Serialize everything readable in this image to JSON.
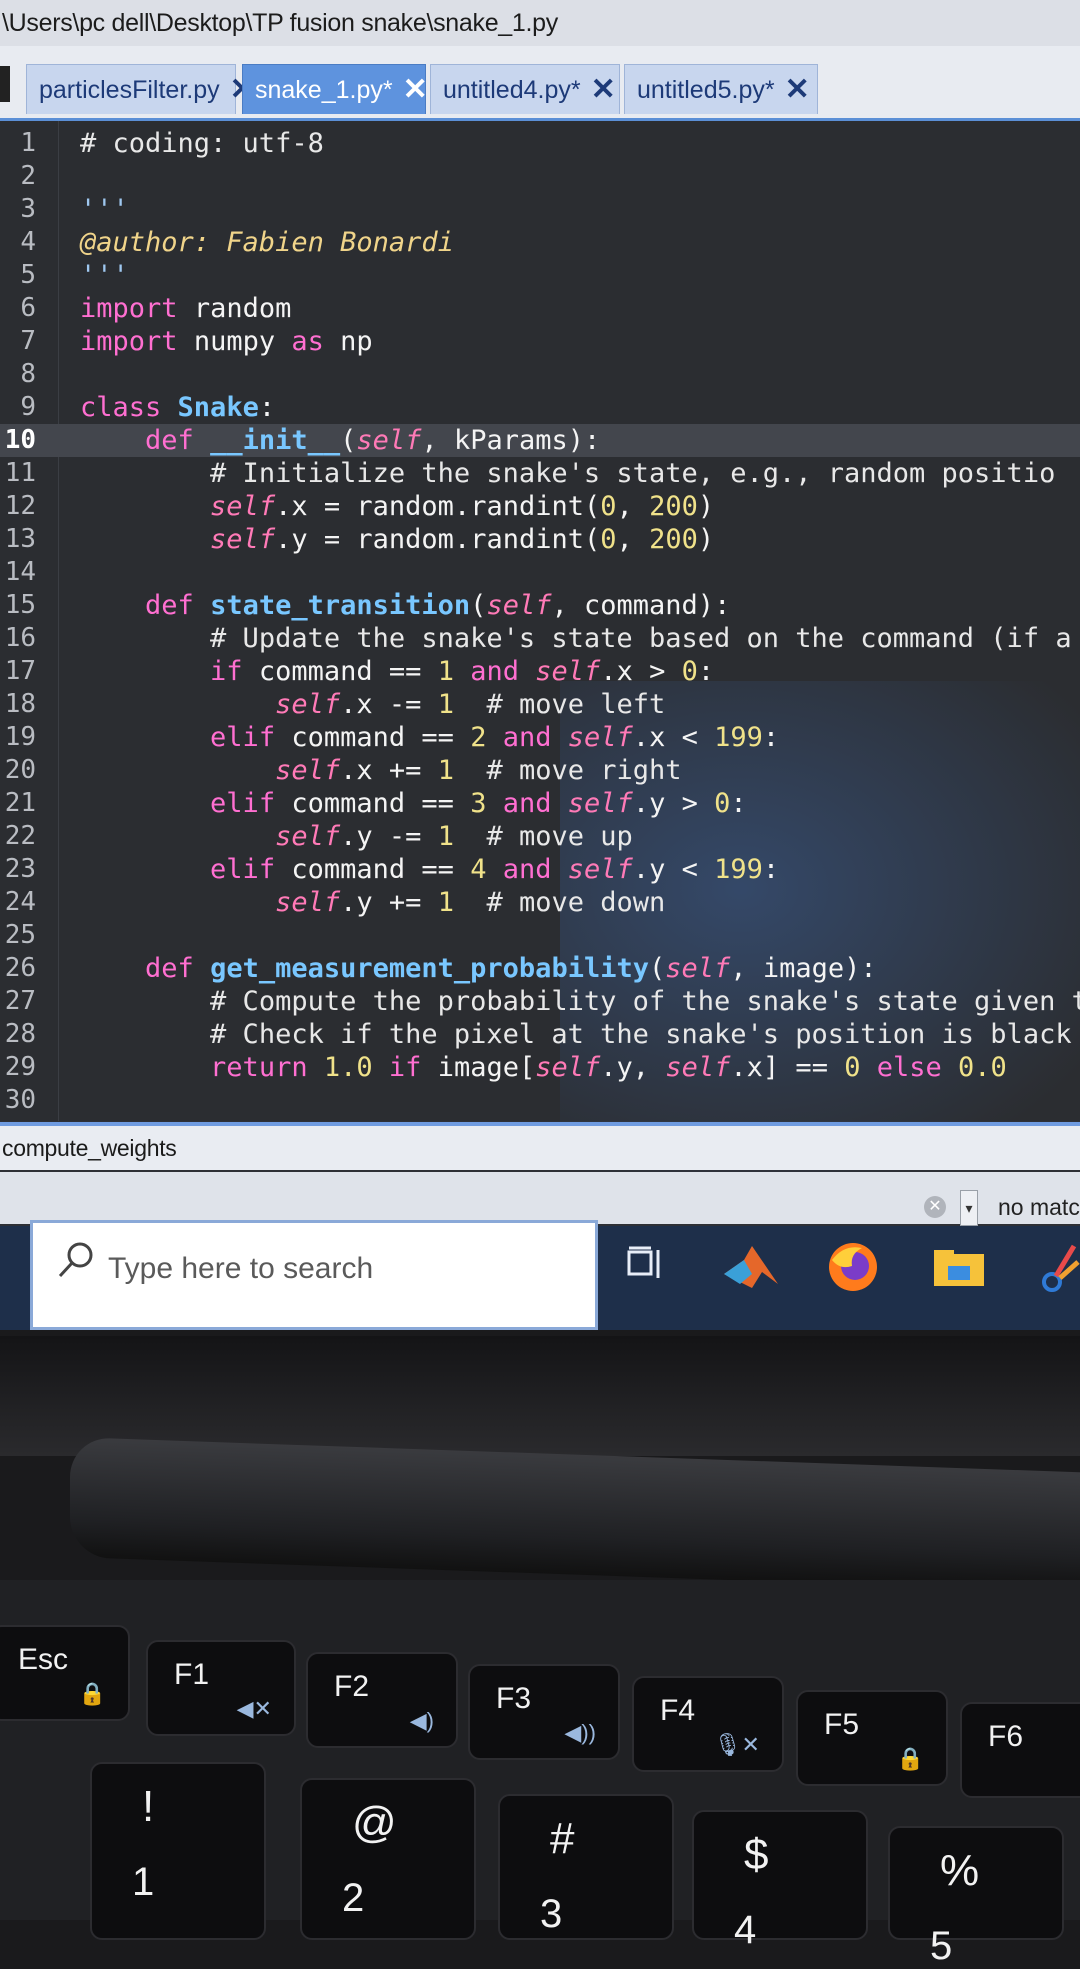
{
  "window": {
    "title": "\\Users\\pc dell\\Desktop\\TP fusion snake\\snake_1.py"
  },
  "tabs": [
    {
      "label": "particlesFilter.py",
      "active": false
    },
    {
      "label": "snake_1.py*",
      "active": true
    },
    {
      "label": "untitled4.py*",
      "active": false
    },
    {
      "label": "untitled5.py*",
      "active": false
    }
  ],
  "editor": {
    "current_line": 10,
    "lines": [
      {
        "n": "1",
        "text": "# coding: utf-8"
      },
      {
        "n": "2",
        "text": ""
      },
      {
        "n": "3",
        "text": "'''"
      },
      {
        "n": "4",
        "text": "@author: Fabien Bonardi"
      },
      {
        "n": "5",
        "text": "'''"
      },
      {
        "n": "6",
        "text": "import random"
      },
      {
        "n": "7",
        "text": "import numpy as np"
      },
      {
        "n": "8",
        "text": ""
      },
      {
        "n": "9",
        "text": "class Snake:"
      },
      {
        "n": "10",
        "text": "    def __init__(self, kParams):"
      },
      {
        "n": "11",
        "text": "        # Initialize the snake's state, e.g., random positio"
      },
      {
        "n": "12",
        "text": "        self.x = random.randint(0, 200)"
      },
      {
        "n": "13",
        "text": "        self.y = random.randint(0, 200)"
      },
      {
        "n": "14",
        "text": ""
      },
      {
        "n": "15",
        "text": "    def state_transition(self, command):"
      },
      {
        "n": "16",
        "text": "        # Update the snake's state based on the command (if a"
      },
      {
        "n": "17",
        "text": "        if command == 1 and self.x > 0:"
      },
      {
        "n": "18",
        "text": "            self.x -= 1  # move left"
      },
      {
        "n": "19",
        "text": "        elif command == 2 and self.x < 199:"
      },
      {
        "n": "20",
        "text": "            self.x += 1  # move right"
      },
      {
        "n": "21",
        "text": "        elif command == 3 and self.y > 0:"
      },
      {
        "n": "22",
        "text": "            self.y -= 1  # move up"
      },
      {
        "n": "23",
        "text": "        elif command == 4 and self.y < 199:"
      },
      {
        "n": "24",
        "text": "            self.y += 1  # move down"
      },
      {
        "n": "25",
        "text": ""
      },
      {
        "n": "26",
        "text": "    def get_measurement_probability(self, image):"
      },
      {
        "n": "27",
        "text": "        # Compute the probability of the snake's state given th"
      },
      {
        "n": "28",
        "text": "        # Check if the pixel at the snake's position is black i"
      },
      {
        "n": "29",
        "text": "        return 1.0 if image[self.y, self.x] == 0 else 0.0"
      },
      {
        "n": "30",
        "text": ""
      }
    ]
  },
  "outline": {
    "label": "compute_weights"
  },
  "find": {
    "status": "no matc",
    "clear_icon": "clear-icon"
  },
  "taskbar": {
    "search_placeholder": "Type here to search",
    "icons": [
      "task-view-icon",
      "matlab-icon",
      "firefox-icon",
      "file-explorer-icon",
      "snipping-tool-icon"
    ]
  },
  "keyboard": {
    "function_row": [
      {
        "label": "Esc",
        "sub": "Fn lock"
      },
      {
        "label": "F1",
        "sub": "mute"
      },
      {
        "label": "F2",
        "sub": "volume down"
      },
      {
        "label": "F3",
        "sub": "volume up"
      },
      {
        "label": "F4",
        "sub": "mic mute"
      },
      {
        "label": "F5",
        "sub": "num lock"
      },
      {
        "label": "F6",
        "sub": ""
      }
    ],
    "number_row": [
      {
        "top": "!",
        "bottom": "1"
      },
      {
        "top": "@",
        "bottom": "2"
      },
      {
        "top": "#",
        "bottom": "3"
      },
      {
        "top": "$",
        "bottom": "4"
      },
      {
        "top": "%",
        "bottom": "5"
      }
    ]
  },
  "colors": {
    "tab_active": "#5e93de",
    "editor_bg": "#2b2d31",
    "keyword": "#ff6fd1",
    "function_name": "#79c7ff",
    "self": "#ff7ab7",
    "number": "#f0e28a"
  }
}
